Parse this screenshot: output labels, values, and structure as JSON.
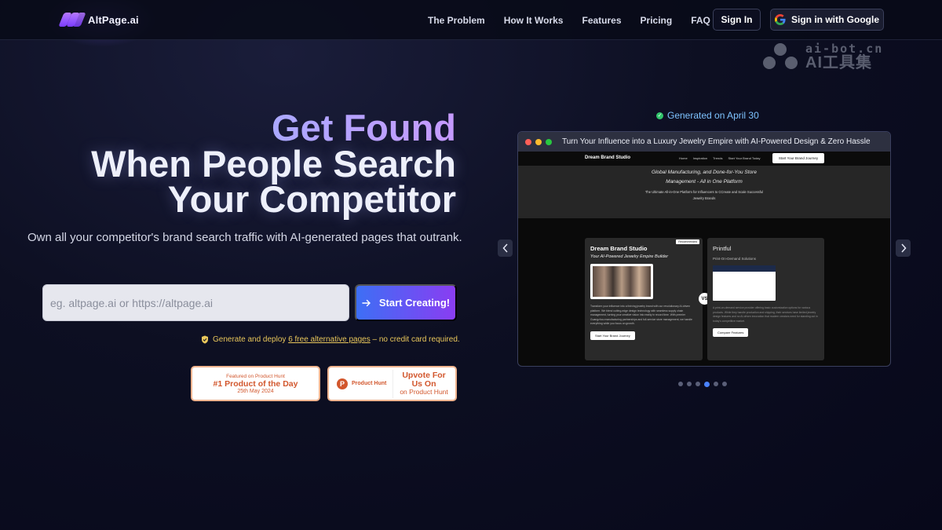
{
  "nav": {
    "logo_text": "AltPage.ai",
    "links": [
      "The Problem",
      "How It Works",
      "Features",
      "Pricing",
      "FAQ"
    ],
    "sign_in": "Sign In",
    "sign_in_google": "Sign in with Google"
  },
  "watermark": {
    "line1": "ai-bot.cn",
    "line2": "AI工具集"
  },
  "hero": {
    "title_line1": "Get Found",
    "title_line2": "When People Search",
    "title_line3": "Your Competitor",
    "subtitle": "Own all your competitor's brand search traffic with AI-generated pages that outrank.",
    "input_placeholder": "eg. altpage.ai or https://altpage.ai",
    "start_button": "Start Creating!",
    "note_prefix": "Generate and deploy ",
    "note_link": "6 free alternative pages",
    "note_suffix": " – no credit card required."
  },
  "product_hunt": {
    "badge1_top": "Featured on Product Hunt",
    "badge1_main": "#1 Product of the Day",
    "badge1_date": "25th May 2024",
    "badge2_logo_letter": "P",
    "badge2_name": "Product Hunt",
    "badge2_line1": "Upvote For",
    "badge2_line2": "Us On",
    "badge2_line3": "on Product Hunt"
  },
  "preview": {
    "generated_label": "Generated on April 30",
    "window_title": "Turn Your Influence into a Luxury Jewelry Empire with AI-Powered Design & Zero Hassle",
    "site_brand": "Dream Brand Studio",
    "site_links": [
      "Home",
      "Inspiration",
      "Trends",
      "Start Your Brand Today"
    ],
    "site_cta": "Start Your Brand Journey",
    "hero_line1": "Global Manufacturing, and Done-for-You Store",
    "hero_line2": "Management - All in One Platform",
    "hero_sub1": "The Ultimate All-in-One Platform for Influencers to CCreate and Scale Successful",
    "hero_sub2": "Jewelry Brands",
    "left_card": {
      "tag": "Recommended",
      "title": "Dream Brand Studio",
      "subtitle": "Your AI-Powered Jewelry Empire Builder",
      "body": "Transform your influence into a thriving jewelry brand with our revolutionary AI-driven platform. We blend cutting-edge design technology with seamless supply chain management, turning your creative vision into reality in record time. With premier Guangzhou manufacturing partnerships and full-service store management, we handle everything while you focus on growth.",
      "button": "Start Your Brand Journey"
    },
    "vs_label": "VS",
    "right_card": {
      "title": "Printful",
      "subtitle": "Print-On-Demand Solutions",
      "body": "A print-on-demand service provider offering basic customization options for various products. While they handle production and shipping, their services have limited jewelry design features and no AI-driven innovation that modern creators need for standing out in today's competitive market.",
      "button": "Compare Features"
    },
    "carousel_count": 6,
    "carousel_active": 4
  },
  "colors": {
    "accent_blue": "#3d6ff5",
    "accent_purple": "#8a3df2",
    "note_yellow": "#e9c75b",
    "product_hunt_orange": "#d2572d",
    "generated_green": "#31c46b"
  }
}
